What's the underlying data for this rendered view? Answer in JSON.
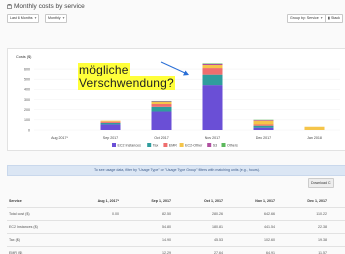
{
  "page": {
    "title": "Monthly costs by service"
  },
  "toolbar": {
    "range_label": "Last 6 Months",
    "granularity_label": "Monthly",
    "group_by_label": "Group by: Service",
    "more_label": "Stack"
  },
  "chart_data": {
    "type": "bar",
    "stacked": true,
    "ylabel": "Costs ($)",
    "yticks": [
      0,
      100,
      200,
      300,
      400,
      500,
      600
    ],
    "ylim": [
      0,
      650
    ],
    "categories": [
      "Aug 2017*",
      "Sep 2017",
      "Oct 2017",
      "Nov 2017",
      "Dec 2017",
      "Jan 2018"
    ],
    "series": [
      {
        "name": "EC2 Instances",
        "color": "#6a4fd6",
        "values": [
          0,
          55,
          182,
          442,
          23,
          0
        ]
      },
      {
        "name": "Tax",
        "color": "#2f9d9d",
        "values": [
          0,
          15,
          46,
          103,
          19,
          0
        ]
      },
      {
        "name": "EMR",
        "color": "#ef6e6e",
        "values": [
          0,
          12,
          28,
          65,
          12,
          0
        ]
      },
      {
        "name": "EC2-Other",
        "color": "#f5c54a",
        "values": [
          0,
          10,
          20,
          30,
          38,
          32
        ]
      },
      {
        "name": "S3",
        "color": "#b04fa0",
        "values": [
          0,
          0,
          6,
          10,
          6,
          0
        ]
      },
      {
        "name": "Others",
        "color": "#5cb85c",
        "values": [
          0,
          0,
          4,
          5,
          3,
          0
        ]
      }
    ],
    "legend_position": "bottom",
    "grid": true
  },
  "annotation": {
    "line1": "mögliche",
    "line2": "Verschwendung?"
  },
  "hint": {
    "text": "To see usage data, filter by \"Usage Type\" or \"Usage Type Group\" filters with matching units (e.g., hours)."
  },
  "download_label": "Download C",
  "table": {
    "headers": [
      "Service",
      "Aug 1, 2017*",
      "Sep 1, 2017",
      "Oct 1, 2017",
      "Nov 1, 2017",
      "Dec 1, 2017",
      "Jan"
    ],
    "rows": [
      [
        "Total cost ($)",
        "0.00",
        "82.50",
        "280.26",
        "642.66",
        "110.22",
        ""
      ],
      [
        "EC2 Instances ($)",
        "",
        "54.80",
        "180.81",
        "441.54",
        "22.38",
        ""
      ],
      [
        "Tax ($)",
        "",
        "14.90",
        "45.53",
        "102.60",
        "19.38",
        ""
      ],
      [
        "EMR ($)",
        "",
        "12.29",
        "27.64",
        "64.91",
        "11.57",
        ""
      ]
    ]
  }
}
